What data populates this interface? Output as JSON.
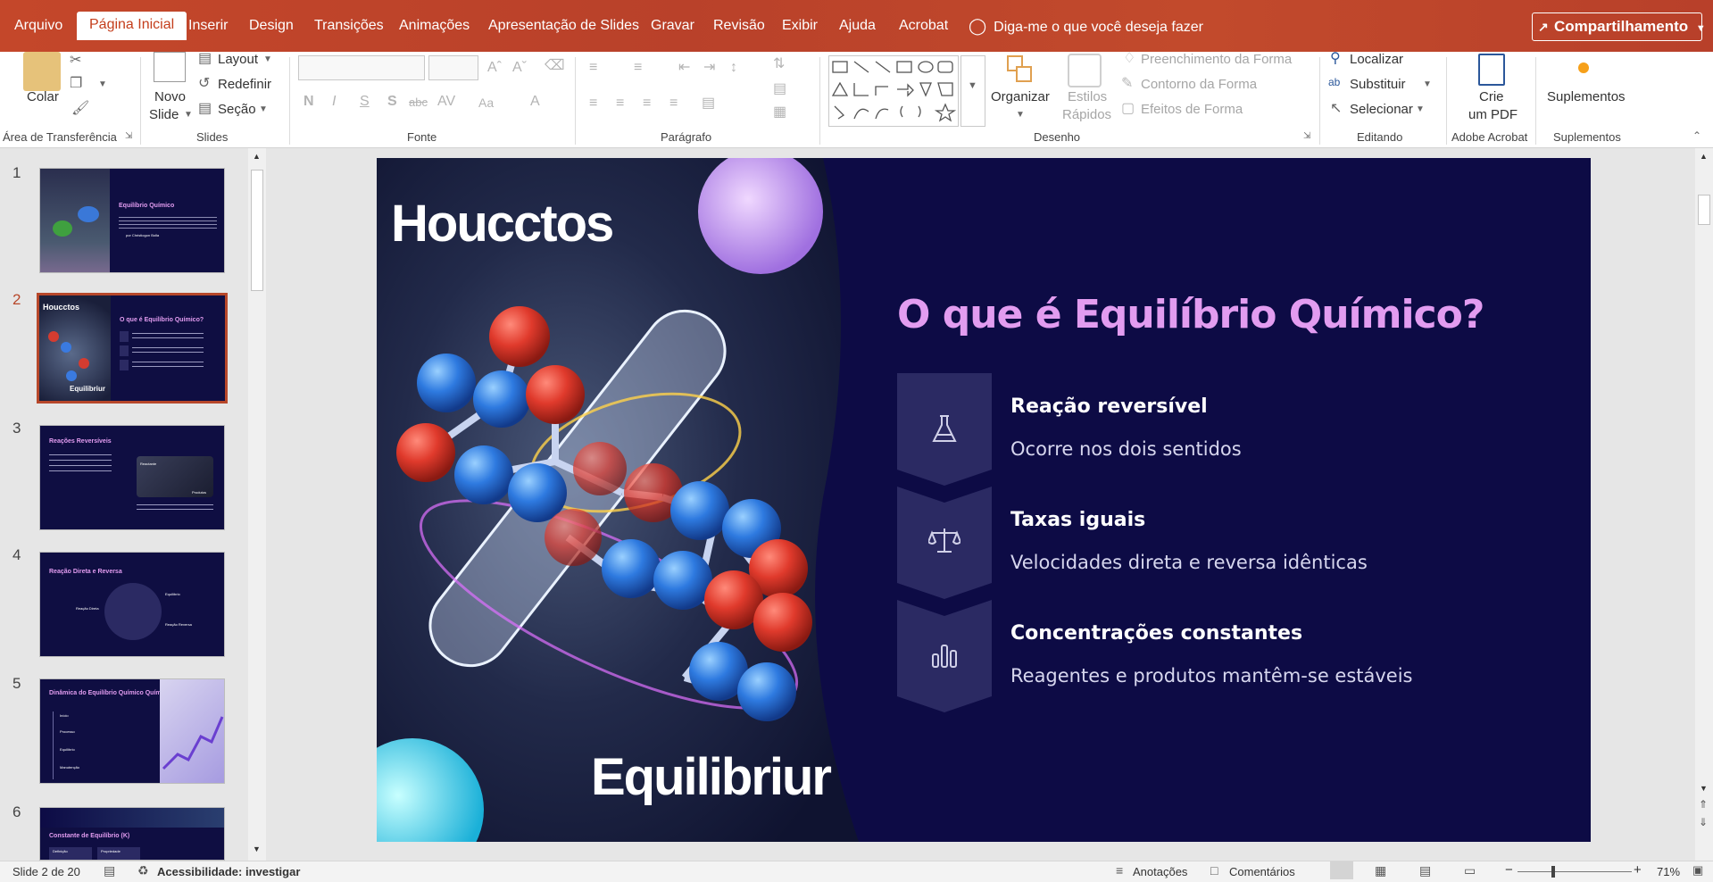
{
  "ribbon_tabs": [
    "Arquivo",
    "Página Inicial",
    "Inserir",
    "Design",
    "Transições",
    "Animações",
    "Apresentação de Slides",
    "Gravar",
    "Revisão",
    "Exibir",
    "Ajuda",
    "Acrobat"
  ],
  "tell_me": "Diga-me o que você deseja fazer",
  "share_label": "Compartilhamento",
  "groups": {
    "clipboard": {
      "label": "Área de Transferência",
      "paste": "Colar"
    },
    "slides": {
      "label": "Slides",
      "new_slide_1": "Novo",
      "new_slide_2": "Slide",
      "layout": "Layout",
      "reset": "Redefinir",
      "section": "Seção"
    },
    "font": {
      "label": "Fonte"
    },
    "paragraph": {
      "label": "Parágrafo"
    },
    "drawing": {
      "label": "Desenho",
      "arrange": "Organizar",
      "quick_styles_1": "Estilos",
      "quick_styles_2": "Rápidos",
      "shape_fill": "Preenchimento da Forma",
      "shape_outline": "Contorno da Forma",
      "shape_effects": "Efeitos de Forma"
    },
    "editing": {
      "label": "Editando",
      "find": "Localizar",
      "replace": "Substituir",
      "select": "Selecionar"
    },
    "acrobat": {
      "label": "Adobe Acrobat",
      "create_1": "Crie",
      "create_2": "um PDF"
    },
    "addins": {
      "label": "Suplementos",
      "addins": "Suplementos"
    }
  },
  "thumbnails": [
    {
      "num": "1",
      "title": "Equilíbrio Químico",
      "subtitle": "por Christiogon Bolla"
    },
    {
      "num": "2",
      "title": "O que é Equilíbrio Químico?",
      "left_title": "Houcctos",
      "left_bottom": "Equilibriur"
    },
    {
      "num": "3",
      "title": "Reações Reversíveis",
      "caption_1": "Reactante",
      "caption_2": "Produtos"
    },
    {
      "num": "4",
      "title": "Reação Direta e Reversa",
      "label_1": "Reação Direta",
      "label_2": "Equilíbrio",
      "label_3": "Reação Reversa"
    },
    {
      "num": "5",
      "title": "Dinâmica do Equilíbrio Químico Químico",
      "items": [
        "Início",
        "Processo",
        "Equilíbrio",
        "Manutenção"
      ]
    },
    {
      "num": "6",
      "title": "Constante de Equilíbrio (K)",
      "col_1": "Definição",
      "col_2": "Propriedade"
    }
  ],
  "slide": {
    "left_title": "Houcctos",
    "left_bottom": "Equilibriur",
    "heading": "O que é Equilíbrio Químico?",
    "items": [
      {
        "icon": "flask-icon",
        "title": "Reação reversível",
        "desc": "Ocorre nos dois sentidos"
      },
      {
        "icon": "balance-scale-icon",
        "title": "Taxas iguais",
        "desc": "Velocidades direta e reversa idênticas"
      },
      {
        "icon": "bar-chart-icon",
        "title": "Concentrações constantes",
        "desc": "Reagentes e produtos mantêm-se estáveis"
      }
    ]
  },
  "status": {
    "slide_counter": "Slide 2 de 20",
    "accessibility": "Acessibilidade: investigar",
    "notes": "Anotações",
    "comments": "Comentários",
    "zoom": "71%"
  },
  "colors": {
    "ribbon": "#c4472a",
    "slide_bg": "#0d0b45",
    "heading": "#e29cf0",
    "item_box": "#2b2a63"
  }
}
